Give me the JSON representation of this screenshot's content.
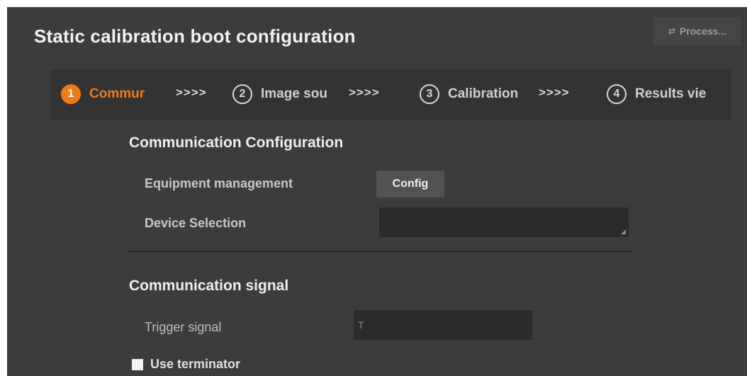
{
  "window": {
    "title": "Static calibration boot configuration"
  },
  "header": {
    "process_button": {
      "label": "Process...",
      "icon": "swap-arrows-icon"
    }
  },
  "steps": [
    {
      "number": "1",
      "label": "Commur",
      "active": true
    },
    {
      "number": "2",
      "label": "Image sou",
      "active": false
    },
    {
      "number": "3",
      "label": "Calibration",
      "active": false
    },
    {
      "number": "4",
      "label": "Results vie",
      "active": false
    }
  ],
  "step_separator": ">>>>",
  "communication_configuration": {
    "heading": "Communication Configuration",
    "equipment_management": {
      "label": "Equipment management",
      "button_label": "Config"
    },
    "device_selection": {
      "label": "Device Selection",
      "value": ""
    }
  },
  "communication_signal": {
    "heading": "Communication signal",
    "trigger_signal": {
      "label": "Trigger signal",
      "value": "T"
    },
    "use_terminator": {
      "label": "Use terminator",
      "checked": false
    }
  },
  "colors": {
    "accent": "#f07a1a",
    "background": "#3c3c3c",
    "field": "#2b2b2b"
  }
}
